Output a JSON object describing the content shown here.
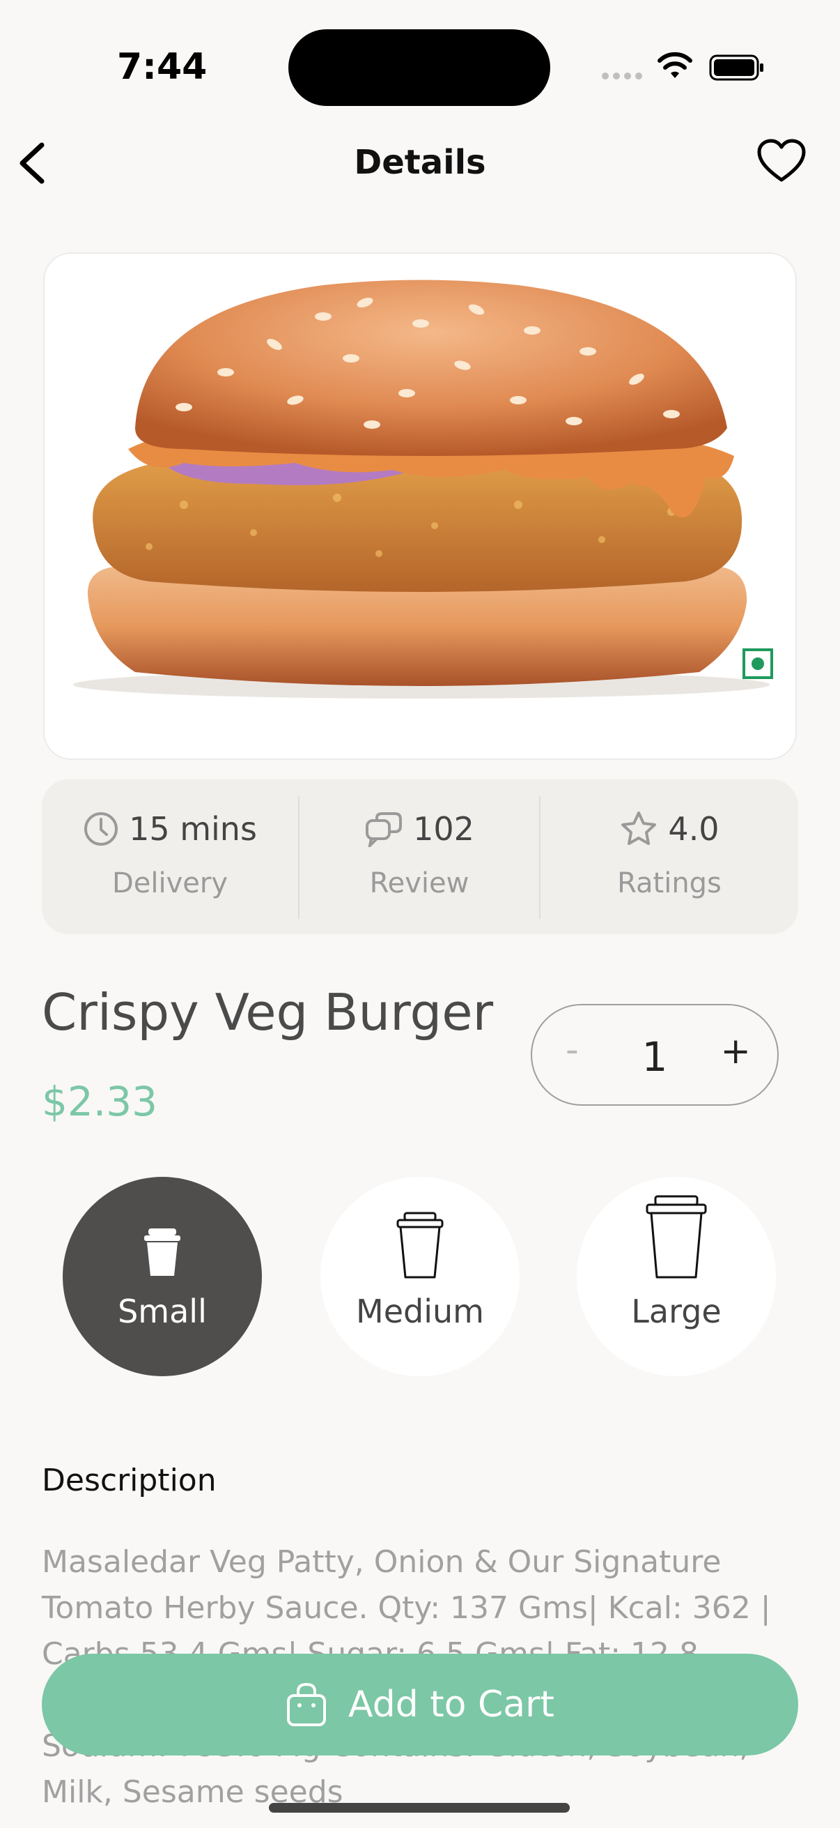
{
  "status_bar": {
    "time": "7:44"
  },
  "header": {
    "title": "Details"
  },
  "stats": [
    {
      "icon": "clock-icon",
      "value": "15 mins",
      "label": "Delivery"
    },
    {
      "icon": "chat-bubbles-icon",
      "value": "102",
      "label": "Review"
    },
    {
      "icon": "star-icon",
      "value": "4.0",
      "label": "Ratings"
    }
  ],
  "product": {
    "name": "Crispy Veg Burger",
    "price": "$2.33"
  },
  "quantity": {
    "minus": "-",
    "value": "1",
    "plus": "+"
  },
  "sizes": [
    {
      "label": "Small",
      "selected": true
    },
    {
      "label": "Medium",
      "selected": false
    },
    {
      "label": "Large",
      "selected": false
    }
  ],
  "description": {
    "heading": "Description",
    "text": "Masaledar Veg Patty, Onion & Our Signature Tomato Herby Sauce. Qty: 137 Gms| Kcal: 362 | Carbs 53.4 Gms| Sugar: 6.5 Gms| Fat: 12.8 Gms| Sat Fat: 5.7 Gms| Protein 7.1 Gms| Sodium: 793.6 Mg Contains: Gluten, Soybean, Milk, Sesame seeds"
  },
  "cart_button": {
    "label": "Add to Cart"
  },
  "colors": {
    "accent": "#7cc7a5",
    "price": "#7cc7a8",
    "selected_size": "#4f4e4d"
  }
}
